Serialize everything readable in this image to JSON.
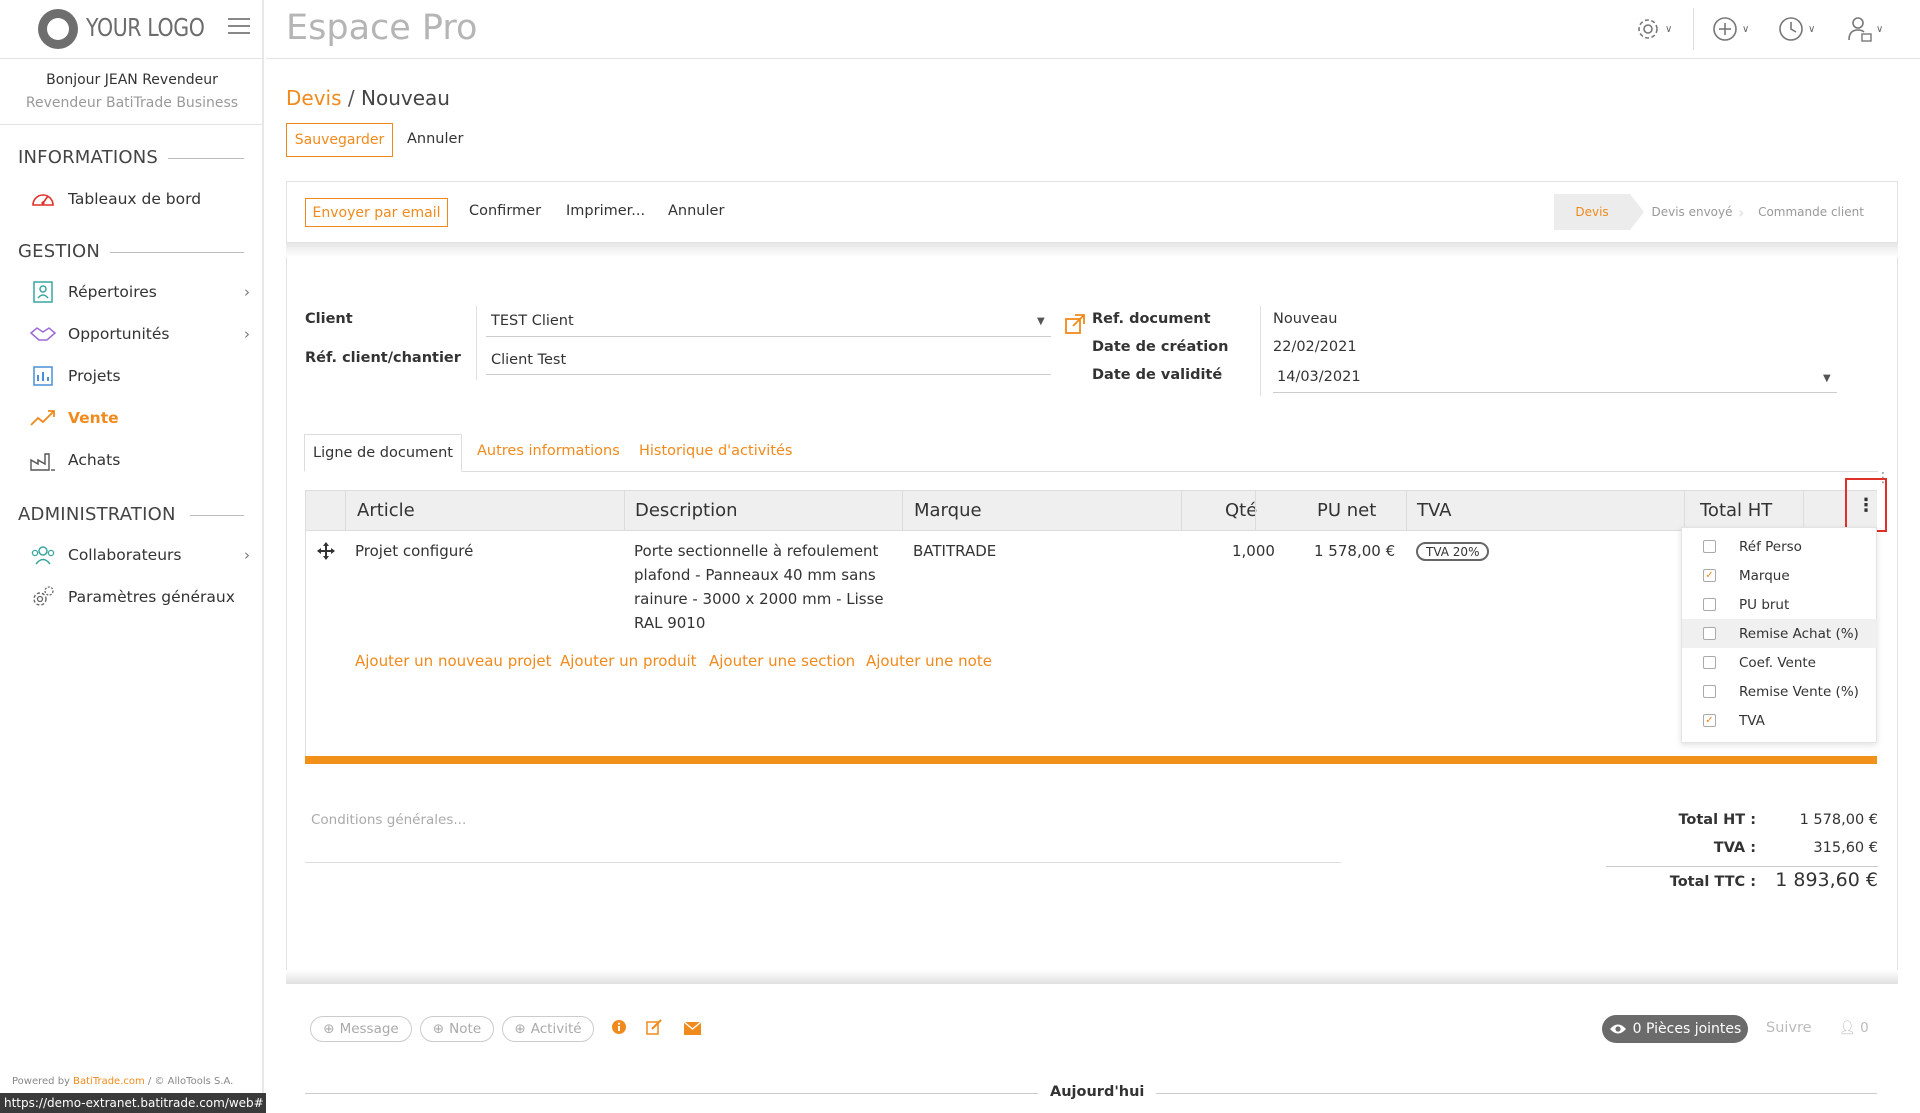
{
  "sidebar": {
    "logo_text": "YOUR LOGO",
    "greeting": "Bonjour JEAN Revendeur",
    "subtitle": "Revendeur BatiTrade Business",
    "sections": {
      "informations": "INFORMATIONS",
      "gestion": "GESTION",
      "administration": "ADMINISTRATION"
    },
    "items": {
      "tableaux": "Tableaux de bord",
      "repertoires": "Répertoires",
      "opportunites": "Opportunités",
      "projets": "Projets",
      "vente": "Vente",
      "achats": "Achats",
      "collaborateurs": "Collaborateurs",
      "parametres": "Paramètres généraux"
    },
    "powered_prefix": "Powered by ",
    "powered_brand": "BatiTrade.com",
    "powered_suffix": " / © AlloTools S.A.",
    "url": "https://demo-extranet.batitrade.com/web#"
  },
  "header": {
    "title": "Espace Pro"
  },
  "breadcrumb": {
    "parent": "Devis",
    "separator": "/",
    "current": "Nouveau"
  },
  "actions": {
    "save": "Sauvegarder",
    "cancel": "Annuler"
  },
  "statusbar": {
    "email": "Envoyer par email",
    "confirm": "Confirmer",
    "print": "Imprimer...",
    "cancel": "Annuler",
    "stages": [
      "Devis",
      "Devis envoyé",
      "Commande client"
    ]
  },
  "form": {
    "client_label": "Client",
    "client_value": "TEST Client",
    "ref_client_label": "Réf. client/chantier",
    "ref_client_value": "Client Test",
    "ref_doc_label": "Ref. document",
    "ref_doc_value": "Nouveau",
    "date_creation_label": "Date de création",
    "date_creation_value": "22/02/2021",
    "date_validite_label": "Date de validité",
    "date_validite_value": "14/03/2021"
  },
  "tabs": [
    "Ligne de document",
    "Autres informations",
    "Historique d'activités"
  ],
  "table": {
    "headers": [
      "Article",
      "Description",
      "Marque",
      "Qté",
      "PU net",
      "TVA",
      "Total HT"
    ],
    "row": {
      "article": "Projet configuré",
      "description": "Porte sectionnelle à refoulement plafond - Panneaux 40 mm sans rainure - 3000 x 2000 mm - Lisse RAL 9010",
      "marque": "BATITRADE",
      "qte": "1,000",
      "pu_net": "1 578,00 €",
      "tva": "TVA 20%"
    },
    "add_links": [
      "Ajouter un nouveau projet",
      "Ajouter un produit",
      "Ajouter une section",
      "Ajouter une note"
    ]
  },
  "column_menu": [
    {
      "label": "Réf Perso",
      "checked": false
    },
    {
      "label": "Marque",
      "checked": true
    },
    {
      "label": "PU brut",
      "checked": false
    },
    {
      "label": "Remise Achat (%)",
      "checked": false
    },
    {
      "label": "Coef. Vente",
      "checked": false
    },
    {
      "label": "Remise Vente (%)",
      "checked": false
    },
    {
      "label": "TVA",
      "checked": true
    }
  ],
  "totals": {
    "conditions_placeholder": "Conditions générales...",
    "total_ht_label": "Total HT :",
    "total_ht_value": "1 578,00 €",
    "tva_label": "TVA :",
    "tva_value": "315,60 €",
    "total_ttc_label": "Total TTC :",
    "total_ttc_value": "1 893,60 €"
  },
  "chatter": {
    "message": "Message",
    "note": "Note",
    "activity": "Activité",
    "attachments": "0 Pièces jointes",
    "follow": "Suivre",
    "followers": "0",
    "today": "Aujourd'hui"
  },
  "colors": {
    "accent": "#f08a1c",
    "highlight_border": "#e0302a"
  }
}
